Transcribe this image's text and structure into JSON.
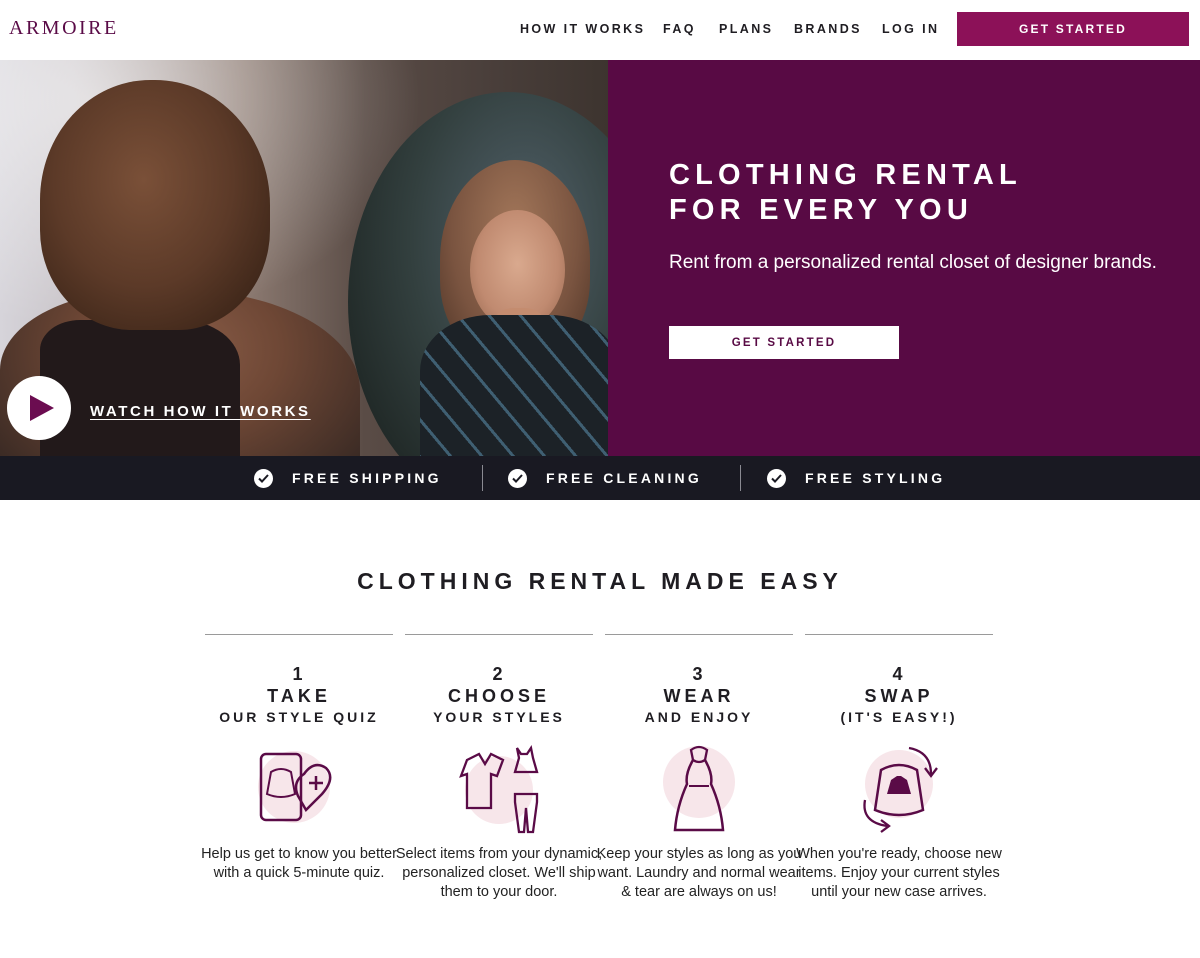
{
  "brand": {
    "logo": "ARMOIRE",
    "accent": "#8c1158",
    "hero_bg": "#580a44",
    "bar_bg": "#191922"
  },
  "nav": {
    "items": [
      {
        "label": "HOW IT WORKS"
      },
      {
        "label": "FAQ"
      },
      {
        "label": "PLANS"
      },
      {
        "label": "BRANDS"
      },
      {
        "label": "LOG IN"
      }
    ],
    "cta": "GET STARTED"
  },
  "hero": {
    "video_link": "WATCH HOW IT WORKS",
    "title_line1": "CLOTHING RENTAL",
    "title_line2": "FOR EVERY YOU",
    "subtitle": "Rent from a personalized rental closet of designer brands.",
    "cta": "GET STARTED"
  },
  "benefits": [
    {
      "label": "FREE SHIPPING",
      "icon": "check-circle-icon"
    },
    {
      "label": "FREE CLEANING",
      "icon": "check-circle-icon"
    },
    {
      "label": "FREE STYLING",
      "icon": "check-circle-icon"
    }
  ],
  "how": {
    "title": "CLOTHING RENTAL MADE EASY",
    "steps": [
      {
        "num": "1",
        "verb": "TAKE",
        "rest": "OUR STYLE QUIZ",
        "icon": "phone-quiz-heart-icon",
        "desc": "Help us get to know you better with a quick 5-minute quiz."
      },
      {
        "num": "2",
        "verb": "CHOOSE",
        "rest": "YOUR STYLES",
        "icon": "clothing-items-icon",
        "desc": "Select items from your dynamic, personalized closet. We'll ship them to your door."
      },
      {
        "num": "3",
        "verb": "WEAR",
        "rest": "AND ENJOY",
        "icon": "dress-icon",
        "desc": "Keep your styles as long as you want. Laundry and normal wear & tear are always on us!"
      },
      {
        "num": "4",
        "verb": "SWAP",
        "rest": "(IT'S EASY!)",
        "icon": "swap-bag-icon",
        "desc": "When you're ready, choose new items. Enjoy your current styles until your new case arrives."
      }
    ]
  }
}
